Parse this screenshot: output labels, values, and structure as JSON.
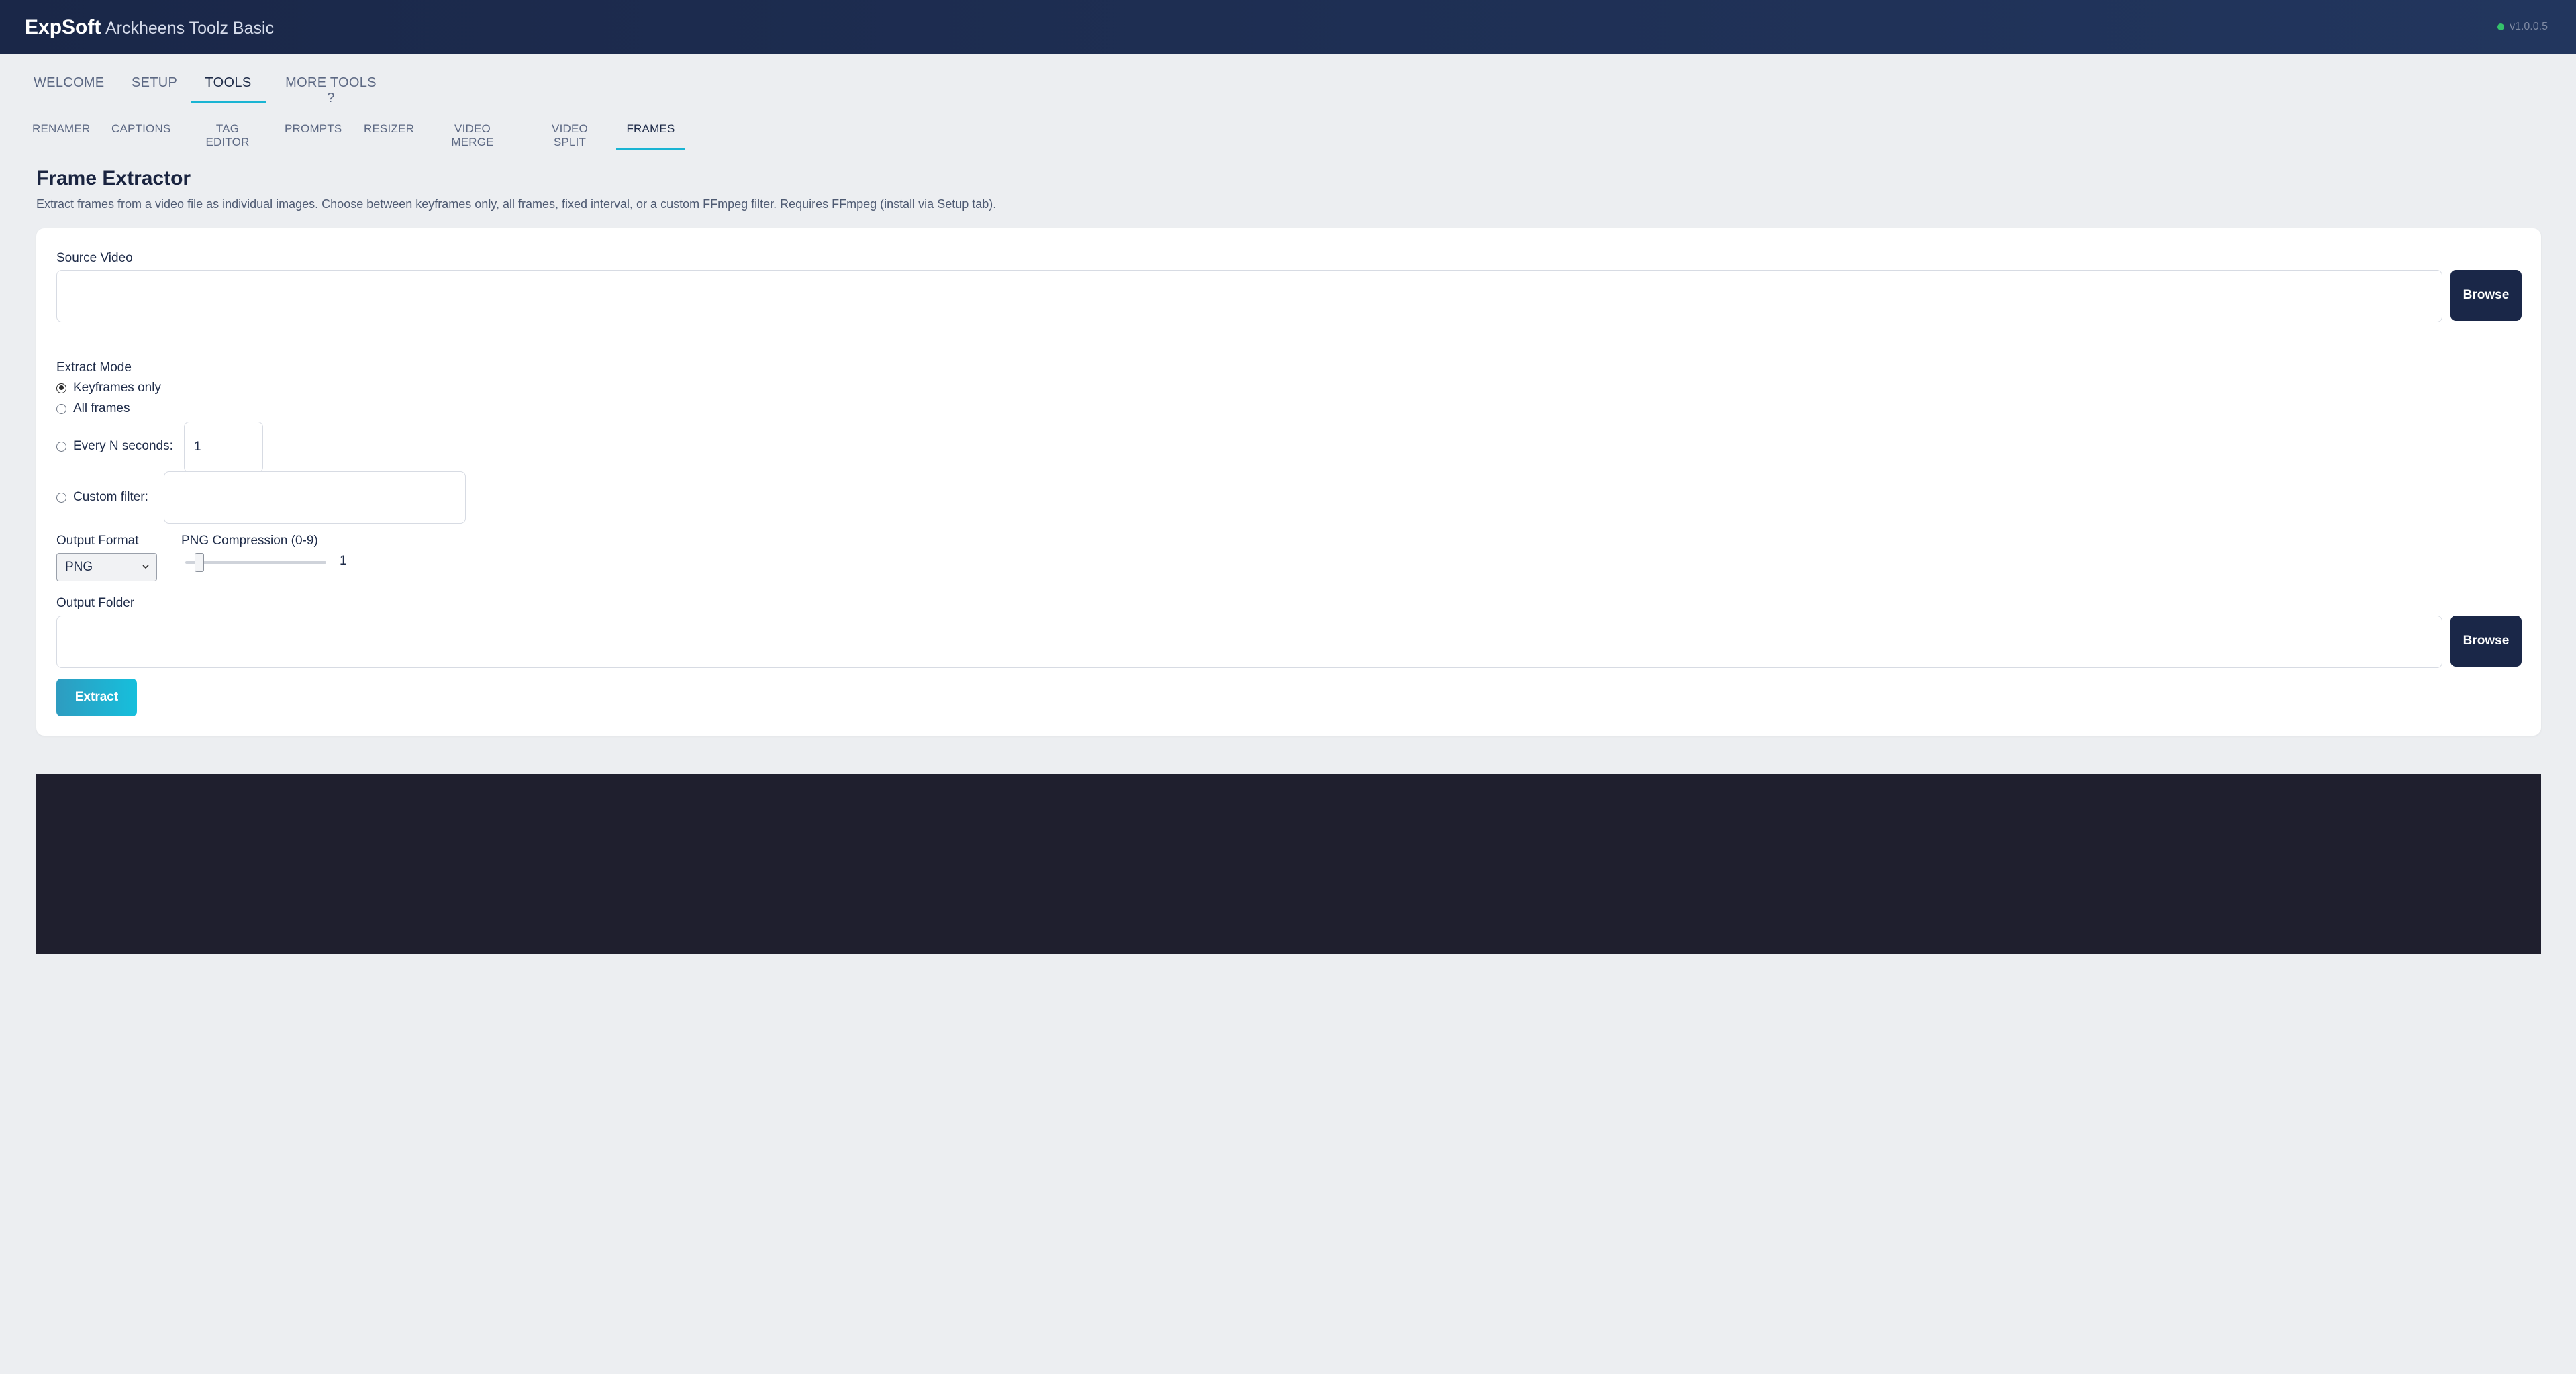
{
  "header": {
    "brand": "ExpSoft",
    "app_name": "Arckheens Toolz Basic",
    "version": "v1.0.0.5",
    "status_color": "#34c26b"
  },
  "main_tabs": [
    {
      "label": "WELCOME",
      "active": false
    },
    {
      "label": "SETUP",
      "active": false
    },
    {
      "label": "TOOLS",
      "active": true
    },
    {
      "label": "MORE TOOLS ?",
      "active": false
    }
  ],
  "sub_tabs": [
    {
      "label": "RENAMER",
      "active": false
    },
    {
      "label": "CAPTIONS",
      "active": false
    },
    {
      "label": "TAG EDITOR",
      "active": false
    },
    {
      "label": "PROMPTS",
      "active": false
    },
    {
      "label": "RESIZER",
      "active": false
    },
    {
      "label": "VIDEO MERGE",
      "active": false
    },
    {
      "label": "VIDEO SPLIT",
      "active": false
    },
    {
      "label": "FRAMES",
      "active": true
    }
  ],
  "page": {
    "title": "Frame Extractor",
    "description": "Extract frames from a video file as individual images. Choose between keyframes only, all frames, fixed interval, or a custom FFmpeg filter. Requires FFmpeg (install via Setup tab)."
  },
  "form": {
    "source_video": {
      "label": "Source Video",
      "value": "",
      "browse_label": "Browse"
    },
    "extract_mode": {
      "label": "Extract Mode",
      "options": [
        {
          "label": "Keyframes only",
          "checked": true
        },
        {
          "label": "All frames",
          "checked": false
        },
        {
          "label": "Every N seconds:",
          "checked": false
        },
        {
          "label": "Custom filter:",
          "checked": false
        }
      ],
      "every_n_seconds_value": "1",
      "custom_filter_value": ""
    },
    "output_format": {
      "label": "Output Format",
      "selected": "PNG"
    },
    "png_compression": {
      "label": "PNG Compression (0-9)",
      "value": "1",
      "min": 0,
      "max": 9
    },
    "output_folder": {
      "label": "Output Folder",
      "value": "",
      "browse_label": "Browse"
    },
    "extract_label": "Extract"
  },
  "colors": {
    "accent": "#19b4d3",
    "header_bg": "#1a2748",
    "page_bg": "#eceef1",
    "log_bg": "#1f1f2e"
  }
}
